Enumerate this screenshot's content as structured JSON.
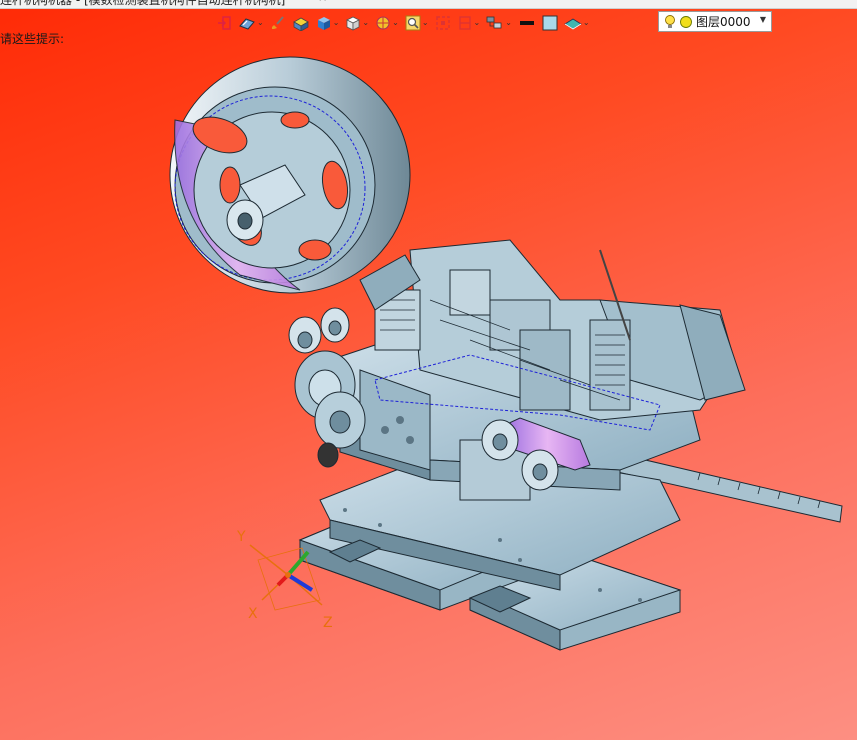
{
  "window": {
    "title": "连杆机构机器 - [模数检测装置机构件自动连杆机构机]",
    "tab_close": "×",
    "tab_more": "▾"
  },
  "toolbar": {
    "items": [
      {
        "name": "exit-sketch-icon"
      },
      {
        "name": "view-orient-icon",
        "dropdown": true
      },
      {
        "name": "brush-icon"
      },
      {
        "name": "part-color-icon"
      },
      {
        "name": "shaded-cube-icon",
        "dropdown": true
      },
      {
        "name": "white-cube-icon",
        "dropdown": true
      },
      {
        "name": "section-view-icon",
        "dropdown": true
      },
      {
        "name": "zoom-fit-icon",
        "dropdown": true
      },
      {
        "name": "zoom-window-icon"
      },
      {
        "name": "clip-plane-icon",
        "dropdown": true
      },
      {
        "name": "assembly-nav-icon",
        "dropdown": true
      },
      {
        "name": "line-style-icon"
      },
      {
        "name": "color-swatch-icon"
      },
      {
        "name": "layer-surface-icon",
        "dropdown": true
      }
    ],
    "layer_value": "图层0000"
  },
  "hint_text": "请这些提示:",
  "axes": {
    "x": "X",
    "y": "Y",
    "z": "Z"
  },
  "colors": {
    "bg_top": "#ff2a06",
    "bg_bottom": "#fd8f82",
    "metal": "#a9c4d2",
    "metal_dark": "#5f7f90",
    "edge": "#1d2a33",
    "select": "#1e22d8",
    "highlight": "#d9a0e6",
    "axis_label": "#e8700e"
  }
}
